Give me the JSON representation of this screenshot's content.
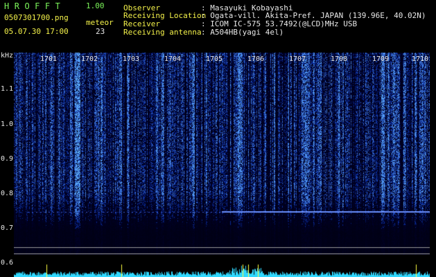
{
  "app": {
    "title": "HROFFT",
    "version": "1.00"
  },
  "file": {
    "name": "0507301700.png",
    "datetime": "05.07.30 17:00"
  },
  "meteor": {
    "label": "meteor",
    "count": "23"
  },
  "info": {
    "rows": [
      {
        "label": "Observer",
        "value": ": Masayuki Kobayashi"
      },
      {
        "label": "Receiving Location",
        "value": ": Ogata-vill. Akita-Pref. JAPAN (139.96E, 40.02N)"
      },
      {
        "label": "Receiver",
        "value": ": ICOM IC-575 53.7492(@LCD)MHz USB"
      },
      {
        "label": "Receiving antenna",
        "value": ": A504HB(yagi 4el)"
      }
    ]
  },
  "axis": {
    "unit": "kHz",
    "y_labels": [
      "1.1",
      "1.0",
      "0.9",
      "0.8",
      "0.7",
      "0.6"
    ],
    "time_ticks": [
      "1701",
      "1702",
      "1703",
      "1704",
      "1705",
      "1706",
      "1707",
      "1708",
      "1709",
      "1710"
    ]
  },
  "colors": {
    "title": "#7cf55a",
    "label": "#f4f24a",
    "text": "#e8e8e8",
    "signal": "#4c7cff",
    "meter": "#30d8ff",
    "peak": "#ffff40"
  }
}
